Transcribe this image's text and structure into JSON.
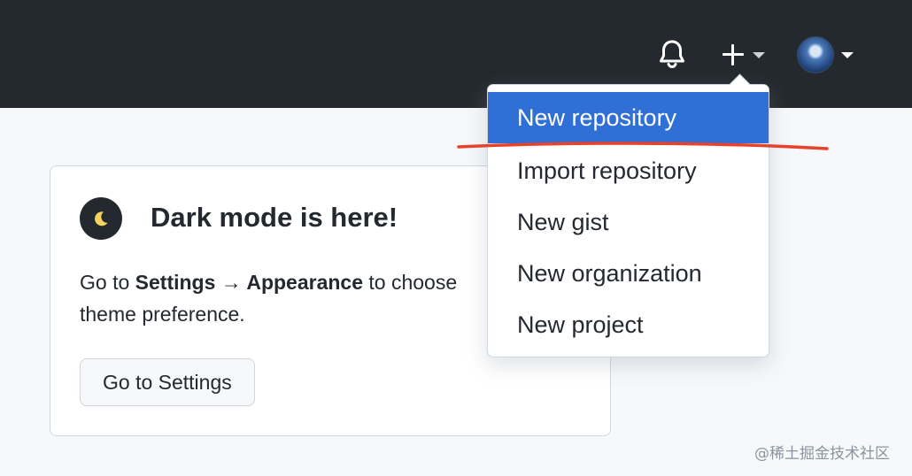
{
  "header": {
    "bell_icon": "bell-icon",
    "plus_icon": "plus-icon",
    "caret_icon": "caret-down-icon",
    "avatar": "user-avatar"
  },
  "dropdown": {
    "items": [
      {
        "label": "New repository",
        "active": true
      },
      {
        "label": "Import repository",
        "active": false
      },
      {
        "label": "New gist",
        "active": false
      },
      {
        "label": "New organization",
        "active": false
      },
      {
        "label": "New project",
        "active": false
      }
    ],
    "highlight_color": "#2f6fd6"
  },
  "card": {
    "moon_icon": "moon-icon",
    "title": "Dark mode is here!",
    "text_prefix": "Go to ",
    "text_settings": "Settings",
    "text_arrow": " → ",
    "text_appearance": "Appearance",
    "text_suffix": " to choose",
    "text_line2": "theme preference.",
    "button_label": "Go to Settings"
  },
  "annotation": {
    "color": "#e8412c"
  },
  "watermark": "@稀土掘金技术社区",
  "colors": {
    "header_bg": "#24292f",
    "page_bg": "#f6f8fa"
  }
}
